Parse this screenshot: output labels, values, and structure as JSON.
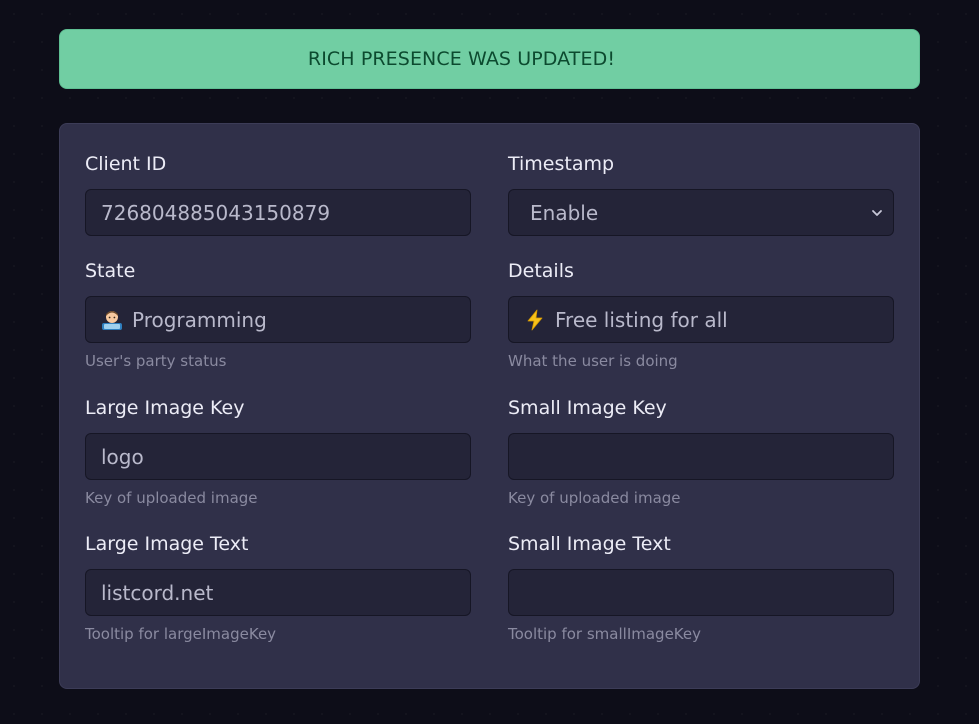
{
  "alert": {
    "message": "RICH PRESENCE WAS UPDATED!"
  },
  "form": {
    "client_id": {
      "label": "Client ID",
      "value": "726804885043150879"
    },
    "timestamp": {
      "label": "Timestamp",
      "selected": "Enable",
      "icon": "chevron-down-icon"
    },
    "state": {
      "label": "State",
      "value": "Programming",
      "icon": "technologist-emoji-icon",
      "help": "User's party status"
    },
    "details": {
      "label": "Details",
      "value": "Free listing for all",
      "icon": "lightning-emoji-icon",
      "help": "What the user is doing"
    },
    "large_image_key": {
      "label": "Large Image Key",
      "value": "logo",
      "help": "Key of uploaded image"
    },
    "small_image_key": {
      "label": "Small Image Key",
      "value": "",
      "help": "Key of uploaded image"
    },
    "large_image_text": {
      "label": "Large Image Text",
      "value": "listcord.net",
      "help": "Tooltip for largeImageKey"
    },
    "small_image_text": {
      "label": "Small Image Text",
      "value": "",
      "help": "Tooltip for smallImageKey"
    }
  },
  "colors": {
    "alert_bg": "#71cea3",
    "alert_text": "#0c4a2f",
    "card_bg": "#303049",
    "input_bg": "#242438",
    "page_bg": "#0d0d18"
  }
}
